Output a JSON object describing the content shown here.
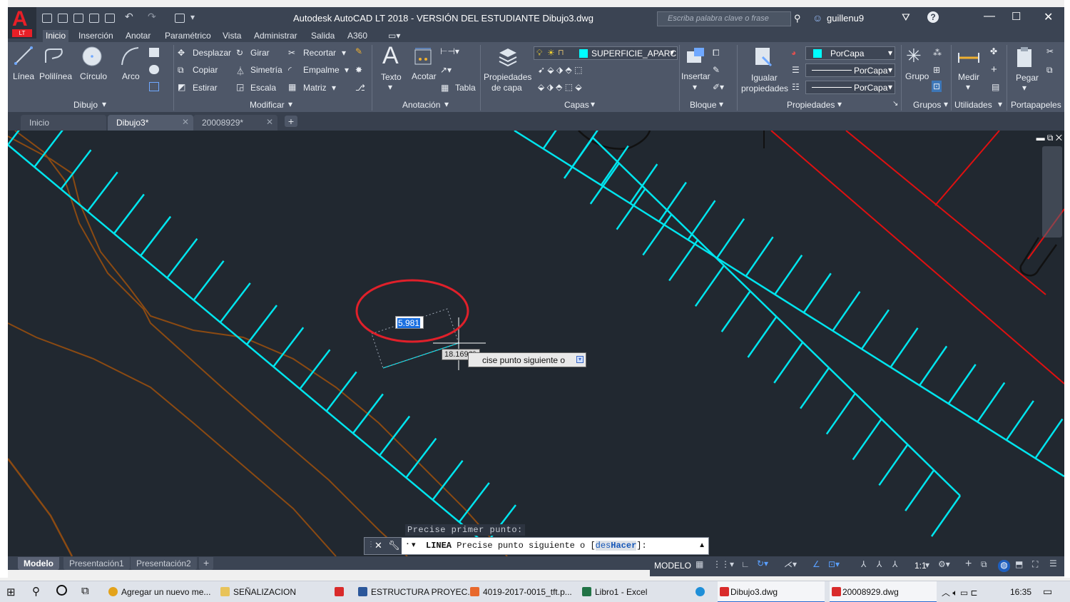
{
  "window": {
    "title": "Autodesk AutoCAD LT 2018 - VERSIÓN DEL ESTUDIANTE    Dibujo3.dwg",
    "search_placeholder": "Escriba palabra clave o frase",
    "user": "guillenu9",
    "logo_sub": "LT"
  },
  "ribbon_tabs": [
    "Inicio",
    "Inserción",
    "Anotar",
    "Paramétrico",
    "Vista",
    "Administrar",
    "Salida",
    "A360"
  ],
  "ribbon": {
    "dibujo": {
      "linea": "Línea",
      "polilinea": "Polilínea",
      "circulo": "Círculo",
      "arco": "Arco",
      "panel": "Dibujo"
    },
    "modificar": {
      "desplazar": "Desplazar",
      "girar": "Girar",
      "recortar": "Recortar",
      "copiar": "Copiar",
      "simetria": "Simetría",
      "empalme": "Empalme",
      "estirar": "Estirar",
      "escala": "Escala",
      "matriz": "Matriz",
      "panel": "Modificar"
    },
    "anotacion": {
      "texto": "Texto",
      "acotar": "Acotar",
      "tabla": "Tabla",
      "panel": "Anotación"
    },
    "capas": {
      "props_line1": "Propiedades",
      "props_line2": "de capa",
      "layer_name": "SUPERFICIE_APARC",
      "layer_color": "#00ffff",
      "panel": "Capas"
    },
    "bloque": {
      "insertar": "Insertar",
      "panel": "Bloque"
    },
    "propiedades": {
      "igualar_line1": "Igualar",
      "igualar_line2": "propiedades",
      "color": "PorCapa",
      "linetype": "PorCapa",
      "lineweight": "PorCapa",
      "panel": "Propiedades"
    },
    "grupos": {
      "grupo": "Grupo",
      "panel": "Grupos"
    },
    "utilidades": {
      "medir": "Medir",
      "panel": "Utilidades"
    },
    "portapapeles": {
      "pegar": "Pegar",
      "panel": "Portapapeles"
    }
  },
  "doc_tabs": [
    {
      "label": "Inicio"
    },
    {
      "label": "Dibujo3*"
    },
    {
      "label": "20008929*"
    }
  ],
  "canvas": {
    "dynamic_input_value": "5.981",
    "angle_value": "18.1696°",
    "tooltip": "cise punto siguiente o",
    "previous_prompt": "Precise primer punto:",
    "colors": {
      "background": "#212830",
      "parking": "#00e5ee",
      "contour": "#8b4a12",
      "property": "#e01010",
      "highlight": "#e0202a"
    }
  },
  "command_line": {
    "command": "LINEA",
    "prompt": "Precise punto siguiente o",
    "option_open": "[",
    "option_des": "des",
    "option_hacer": "Hacer",
    "option_close": "]:"
  },
  "layout_tabs": [
    "Modelo",
    "Presentación1",
    "Presentación2"
  ],
  "status": {
    "space": "MODELO",
    "scale": "1:1"
  },
  "taskbar": {
    "apps": [
      {
        "label": "Agregar un nuevo me...",
        "color": "#e3a21a"
      },
      {
        "label": "SEÑALIZACION",
        "color": "#e8c35a"
      },
      {
        "label": "ESTRUCTURA PROYEC...",
        "color": "#2b579a"
      },
      {
        "label": "4019-2017-0015_tft.p...",
        "color": "#e8682c"
      },
      {
        "label": "Libro1 - Excel",
        "color": "#217346"
      },
      {
        "label": "Dibujo3.dwg",
        "color": "#d92b2b"
      },
      {
        "label": "20008929.dwg",
        "color": "#d92b2b"
      }
    ],
    "time": "16:35"
  }
}
